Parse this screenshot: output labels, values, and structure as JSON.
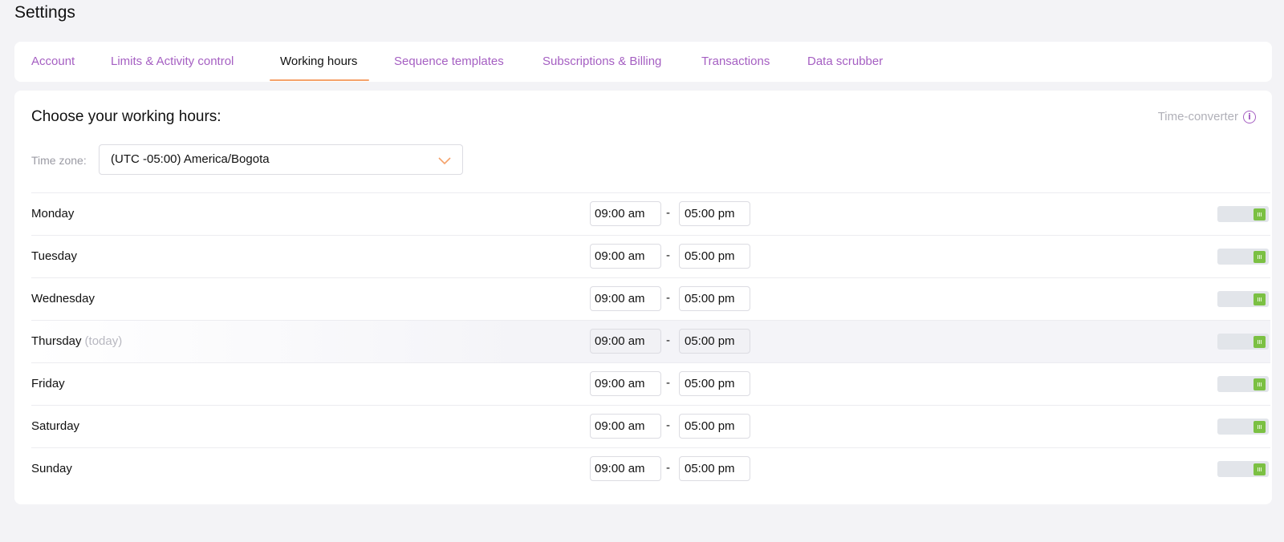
{
  "page": {
    "title": "Settings"
  },
  "tabs": [
    {
      "label": "Account",
      "active": false
    },
    {
      "label": "Limits & Activity control",
      "active": false
    },
    {
      "label": "Working hours",
      "active": true
    },
    {
      "label": "Sequence templates",
      "active": false
    },
    {
      "label": "Subscriptions & Billing",
      "active": false
    },
    {
      "label": "Transactions",
      "active": false
    },
    {
      "label": "Data scrubber",
      "active": false
    }
  ],
  "working_hours": {
    "title": "Choose your working hours:",
    "time_converter_label": "Time-converter",
    "time_converter_icon": "info-icon",
    "timezone_label": "Time zone:",
    "timezone_value": "(UTC -05:00) America/Bogota",
    "separator": "-",
    "today_tag": "(today)",
    "days": [
      {
        "name": "Monday",
        "start": "09:00 am",
        "end": "05:00 pm",
        "enabled": true,
        "today": false
      },
      {
        "name": "Tuesday",
        "start": "09:00 am",
        "end": "05:00 pm",
        "enabled": true,
        "today": false
      },
      {
        "name": "Wednesday",
        "start": "09:00 am",
        "end": "05:00 pm",
        "enabled": true,
        "today": false
      },
      {
        "name": "Thursday",
        "start": "09:00 am",
        "end": "05:00 pm",
        "enabled": true,
        "today": true
      },
      {
        "name": "Friday",
        "start": "09:00 am",
        "end": "05:00 pm",
        "enabled": true,
        "today": false
      },
      {
        "name": "Saturday",
        "start": "09:00 am",
        "end": "05:00 pm",
        "enabled": true,
        "today": false
      },
      {
        "name": "Sunday",
        "start": "09:00 am",
        "end": "05:00 pm",
        "enabled": true,
        "today": false
      }
    ]
  },
  "colors": {
    "accent_purple": "#a55fc2",
    "accent_orange": "#f5a26b",
    "toggle_on": "#7bc043"
  }
}
